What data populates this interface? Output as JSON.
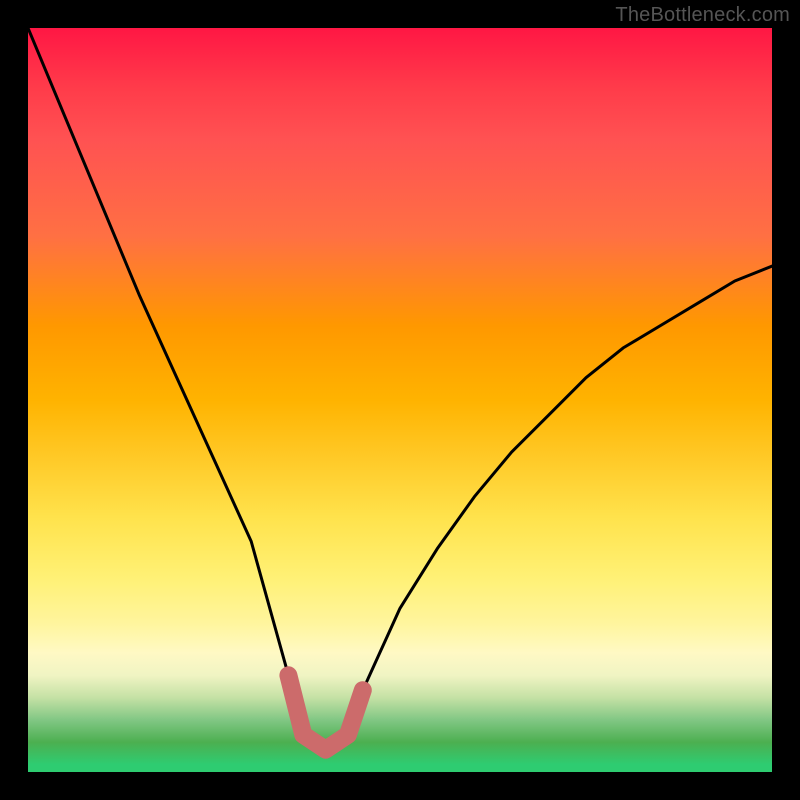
{
  "watermark": "TheBottleneck.com",
  "chart_data": {
    "type": "line",
    "title": "",
    "xlabel": "",
    "ylabel": "",
    "xlim": [
      0,
      100
    ],
    "ylim": [
      0,
      100
    ],
    "grid": false,
    "legend": false,
    "series": [
      {
        "name": "bottleneck-curve",
        "x": [
          0,
          5,
          10,
          15,
          20,
          25,
          30,
          35,
          37,
          40,
          43,
          45,
          50,
          55,
          60,
          65,
          70,
          75,
          80,
          85,
          90,
          95,
          100
        ],
        "values": [
          100,
          88,
          76,
          64,
          53,
          42,
          31,
          13,
          5,
          3,
          5,
          11,
          22,
          30,
          37,
          43,
          48,
          53,
          57,
          60,
          63,
          66,
          68
        ]
      },
      {
        "name": "highlight-band",
        "x": [
          35,
          37,
          40,
          43,
          45
        ],
        "values": [
          13,
          5,
          3,
          5,
          11
        ]
      }
    ],
    "background_gradient_stops": [
      {
        "pos": 0.0,
        "color": "#ff1744"
      },
      {
        "pos": 0.28,
        "color": "#ff7043"
      },
      {
        "pos": 0.5,
        "color": "#ffb300"
      },
      {
        "pos": 0.74,
        "color": "#fff176"
      },
      {
        "pos": 0.9,
        "color": "#c5e1a5"
      },
      {
        "pos": 1.0,
        "color": "#2ecc71"
      }
    ],
    "highlight_color": "#cc6b6b",
    "curve_color": "#000000"
  }
}
